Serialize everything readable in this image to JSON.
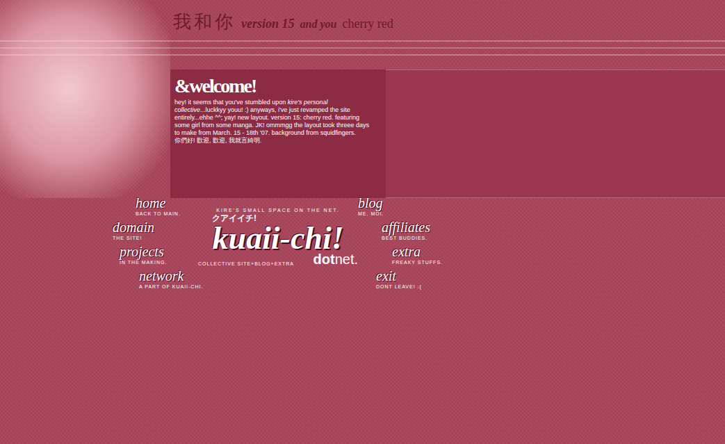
{
  "header": {
    "chinese": "我和你",
    "version": "version 15",
    "subtitle": "and you",
    "theme": "cherry red"
  },
  "welcome": {
    "title": "&welcome!",
    "segments": [
      {
        "text": "hey! it seems that you've stumbled upon ",
        "italic": false
      },
      {
        "text": "kire's personal collective",
        "italic": true
      },
      {
        "text": "...luckkyy youu! :) anyways, i've just revamped the site entirely...ehhe ^^; yay! new layout. version 15: cherry red. featuring some girl from some manga. JK! ommmgg the layout took threee days to make from March. 15 - 18th '07. background from squidfingers.",
        "italic": false
      }
    ],
    "chinese": "你們好! 歡迎, 歡迎, 我就言綺明."
  },
  "logo": {
    "tagline": "KIRE'S SMALL SPACE ON THE NET.",
    "katakana": "クアイイチ!",
    "name": "kuaii-chi!",
    "dot": "dot",
    "net": "net.",
    "footer": "COLLECTIVE SITE+BLOG+EXTRA"
  },
  "nav": {
    "left": [
      {
        "title": "home",
        "sub": "BACK TO MAIN."
      },
      {
        "title": "domain",
        "sub": "THE SITE!"
      },
      {
        "title": "projects",
        "sub": "IN THE MAKING."
      },
      {
        "title": "network",
        "sub": "A PART OF KUAII-CHI."
      }
    ],
    "right": [
      {
        "title": "blog",
        "sub": "ME. MOI."
      },
      {
        "title": "affiliates",
        "sub": "BEST BUDDIES."
      },
      {
        "title": "extra",
        "sub": "FREAKY STUFFS."
      },
      {
        "title": "exit",
        "sub": "DONT LEAVE! :("
      }
    ]
  }
}
